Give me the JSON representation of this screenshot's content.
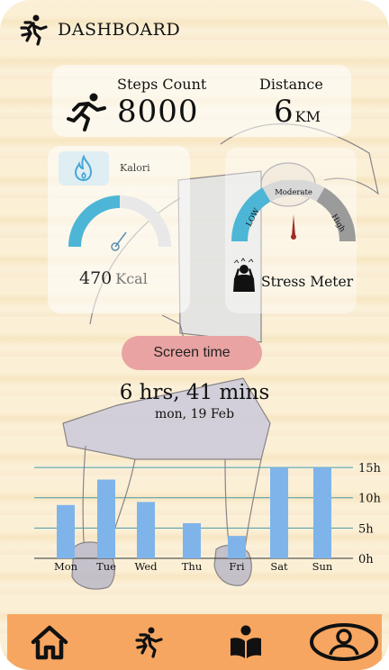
{
  "header": {
    "title": "DASHBOARD",
    "logo_icon": "walking-person-icon"
  },
  "steps": {
    "label": "Steps Count",
    "value": "8000",
    "icon": "running-person-icon"
  },
  "distance": {
    "label": "Distance",
    "value": "6",
    "unit": "KM"
  },
  "kalori": {
    "label": "Kalori",
    "value": "470",
    "unit": "Kcal",
    "icon": "flame-icon",
    "gauge_level": 0.5
  },
  "stress": {
    "label": "Stress Meter",
    "low": "LOW",
    "moderate": "Moderate",
    "high": "High",
    "icon": "stressed-person-icon"
  },
  "screen_time": {
    "button_label": "Screen time",
    "value": "6 hrs, 41 mins",
    "date": "mon, 19 Feb"
  },
  "colors": {
    "accent": "#4db6d6",
    "bar": "#7fb4ea",
    "nav": "#f7a661",
    "button": "#e9a3a3"
  },
  "chart_data": {
    "type": "bar",
    "categories": [
      "Mon",
      "Tue",
      "Wed",
      "Thu",
      "Fri",
      "Sat",
      "Sun"
    ],
    "values": [
      8.8,
      13,
      9.3,
      5.8,
      3.7,
      15,
      15
    ],
    "ylabel": "",
    "xlabel": "",
    "yticks": [
      "0h",
      "5h",
      "10h",
      "15h"
    ],
    "ylim": [
      0,
      16.5
    ],
    "grid": true
  },
  "nav": [
    {
      "name": "home",
      "icon": "home-icon"
    },
    {
      "name": "activity",
      "icon": "walking-person-icon"
    },
    {
      "name": "reading",
      "icon": "book-reader-icon"
    },
    {
      "name": "profile",
      "icon": "user-icon"
    }
  ]
}
